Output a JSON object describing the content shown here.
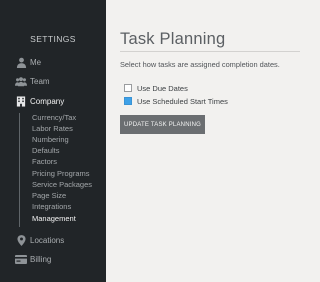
{
  "sidebar": {
    "title": "SETTINGS",
    "items": {
      "me": {
        "label": "Me",
        "icon": "user-icon"
      },
      "team": {
        "label": "Team",
        "icon": "team-icon"
      },
      "company": {
        "label": "Company",
        "icon": "building-icon"
      },
      "locations": {
        "label": "Locations",
        "icon": "location-pin-icon"
      },
      "billing": {
        "label": "Billing",
        "icon": "credit-card-icon"
      }
    },
    "company_subitems": [
      "Currency/Tax",
      "Labor Rates",
      "Numbering",
      "Defaults",
      "Factors",
      "Pricing Programs",
      "Service Packages",
      "Page Size",
      "Integrations",
      "Management"
    ],
    "active_subitem": "Management"
  },
  "main": {
    "title": "Task Planning",
    "description": "Select how tasks are assigned completion dates.",
    "options": [
      {
        "label": "Use Due Dates",
        "checked": false
      },
      {
        "label": "Use Scheduled Start Times",
        "checked": true
      }
    ],
    "update_button": "UPDATE TASK PLANNING"
  },
  "colors": {
    "sidebar_bg": "#212528",
    "main_bg": "#f2f1ef",
    "checkbox_checked": "#3ea1e8",
    "button_bg": "#6b6e71"
  }
}
